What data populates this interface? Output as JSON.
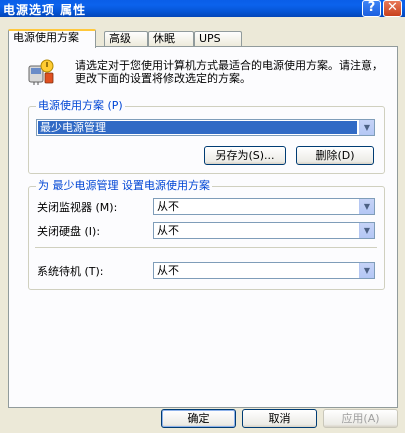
{
  "window": {
    "title": "电源选项 属性",
    "help_glyph": "?",
    "close_glyph": "✕"
  },
  "tabs": [
    {
      "label": "电源使用方案",
      "active": true
    },
    {
      "label": "高级",
      "active": false
    },
    {
      "label": "休眠",
      "active": false
    },
    {
      "label": "UPS",
      "active": false
    }
  ],
  "panel": {
    "description": "请选定对于您使用计算机方式最适合的电源使用方案。请注意，更改下面的设置将修改选定的方案。",
    "icon": "power-scheme-icon"
  },
  "scheme_group": {
    "label": "电源使用方案 (P)",
    "selected_scheme": "最少电源管理",
    "save_as_label": "另存为(S)...",
    "delete_label": "删除(D)"
  },
  "settings_group": {
    "label": "为 最少电源管理 设置电源使用方案",
    "rows": [
      {
        "label": "关闭监视器 (M):",
        "value": "从不"
      },
      {
        "label": "关闭硬盘 (I):",
        "value": "从不"
      },
      {
        "label": "系统待机 (T):",
        "value": "从不"
      }
    ]
  },
  "footer": {
    "ok_label": "确定",
    "cancel_label": "取消",
    "apply_label": "应用(A)"
  },
  "colors": {
    "titlebar": "#0554d4",
    "group_label": "#0046d5",
    "selection": "#316ac5",
    "active_tab_accent": "#ffc83c"
  }
}
